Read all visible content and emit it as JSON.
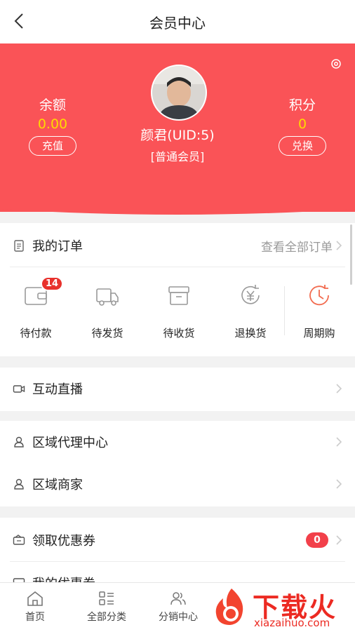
{
  "header": {
    "title": "会员中心"
  },
  "profile": {
    "name": "颜君(UID:5)",
    "level": "[普通会员]",
    "balance": {
      "label": "余额",
      "value": "0.00",
      "button": "充值"
    },
    "points": {
      "label": "积分",
      "value": "0",
      "button": "兑换"
    }
  },
  "orders": {
    "title": "我的订单",
    "view_all": "查看全部订单",
    "items": [
      {
        "label": "待付款",
        "badge": "14"
      },
      {
        "label": "待发货"
      },
      {
        "label": "待收货"
      },
      {
        "label": "退换货"
      },
      {
        "label": "周期购"
      }
    ]
  },
  "menu": {
    "live": "互动直播",
    "agent_center": "区域代理中心",
    "regional_merchant": "区域商家",
    "get_coupons": "领取优惠券",
    "get_coupons_count": "0",
    "my_coupons": "我的优惠券"
  },
  "tabbar": {
    "items": [
      {
        "label": "首页"
      },
      {
        "label": "全部分类"
      },
      {
        "label": "分销中心"
      }
    ]
  },
  "watermark": {
    "brand": "下载火",
    "url": "xiazaihuo.com"
  },
  "colors": {
    "hero": "#fa5357",
    "accent": "#ffd900",
    "badge": "#e8312c",
    "orange_icon": "#f26b4f"
  }
}
